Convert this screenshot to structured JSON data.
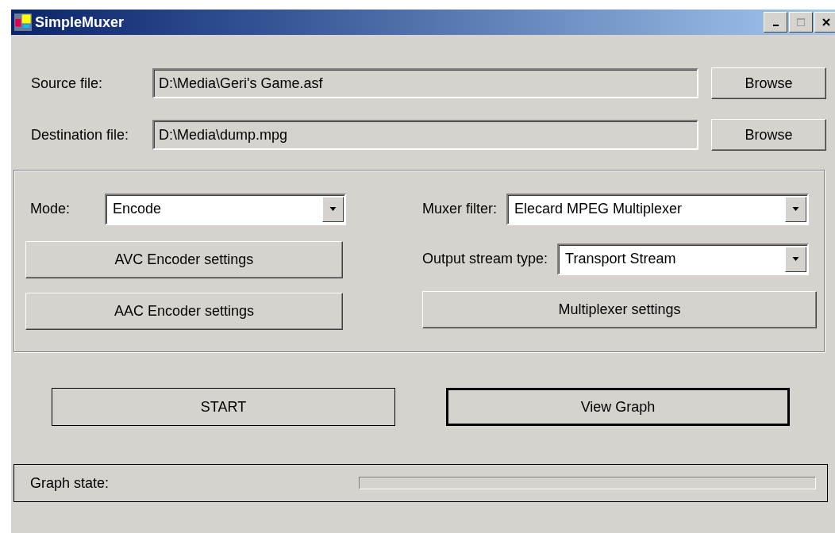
{
  "window": {
    "title": "SimpleMuxer",
    "maximize_disabled": true
  },
  "files": [
    {
      "label": "Source file:",
      "value": "D:\\Media\\Geri's Game.asf",
      "button": "Browse"
    },
    {
      "label": "Destination file:",
      "value": "D:\\Media\\dump.mpg",
      "button": "Browse"
    }
  ],
  "settings": {
    "mode": {
      "label": "Mode:",
      "value": "Encode"
    },
    "avc_button": "AVC Encoder settings",
    "aac_button": "AAC Encoder settings",
    "muxer_filter": {
      "label": "Muxer filter:",
      "value": "Elecard MPEG Multiplexer"
    },
    "output_stream_type": {
      "label": "Output stream type:",
      "value": "Transport Stream"
    },
    "multiplexer_button": "Multiplexer settings"
  },
  "actions": [
    {
      "label": "START",
      "default": false
    },
    {
      "label": "View Graph",
      "default": true
    }
  ],
  "status": {
    "label": "Graph state:",
    "level": 0
  }
}
